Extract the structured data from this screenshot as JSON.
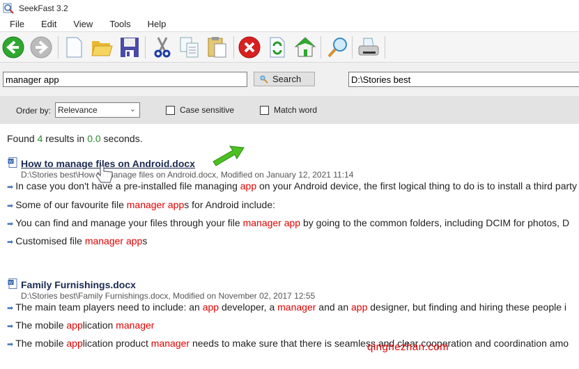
{
  "window": {
    "title": "SeekFast 3.2"
  },
  "menu": [
    "File",
    "Edit",
    "View",
    "Tools",
    "Help"
  ],
  "toolbar": {
    "buttons": [
      {
        "name": "back-icon"
      },
      {
        "name": "forward-icon",
        "disabled": true
      },
      {
        "name": "new-document-icon"
      },
      {
        "name": "open-folder-icon"
      },
      {
        "name": "save-icon"
      },
      {
        "name": "cut-icon"
      },
      {
        "name": "copy-icon"
      },
      {
        "name": "paste-icon"
      },
      {
        "name": "stop-icon"
      },
      {
        "name": "refresh-icon"
      },
      {
        "name": "home-icon"
      },
      {
        "name": "find-icon"
      },
      {
        "name": "print-icon"
      }
    ]
  },
  "search": {
    "query": "manager app",
    "button_label": "Search",
    "folder": "D:\\Stories best"
  },
  "options": {
    "order_label": "Order by:",
    "order_value": "Relevance",
    "case_sensitive_label": "Case sensitive",
    "case_sensitive": false,
    "match_word_label": "Match word",
    "match_word": false
  },
  "summary": {
    "prefix": "Found ",
    "count": "4",
    "middle": " results in ",
    "time": "0.0",
    "suffix": " seconds."
  },
  "results": [
    {
      "title": "How to manage files on Android.docx",
      "path": "D:\\Stories best\\How to manage files on Android.docx, Modified on January 12, 2021 11:14",
      "snippets": [
        [
          {
            "t": "In case you don't have a pre-installed file managing "
          },
          {
            "t": "app",
            "hl": true
          },
          {
            "t": " on your Android device, the first logical thing to do is to install a third party"
          }
        ],
        [
          {
            "t": "Some of our favourite file "
          },
          {
            "t": "manager app",
            "hl": true
          },
          {
            "t": "s for Android include:"
          }
        ],
        [
          {
            "t": "You can find and manage your files through your file "
          },
          {
            "t": "manager app",
            "hl": true
          },
          {
            "t": " by going to the common folders, including DCIM for photos, D"
          }
        ],
        [
          {
            "t": "Customised file "
          },
          {
            "t": "manager app",
            "hl": true
          },
          {
            "t": "s"
          }
        ]
      ]
    },
    {
      "title": "Family Furnishings.docx",
      "path": "D:\\Stories best\\Family Furnishings.docx, Modified on November 02, 2017 12:55",
      "snippets": [
        [
          {
            "t": "The main team players need to include: an "
          },
          {
            "t": "app",
            "hl": true
          },
          {
            "t": " developer, a "
          },
          {
            "t": "manager",
            "hl": true
          },
          {
            "t": " and an "
          },
          {
            "t": "app",
            "hl": true
          },
          {
            "t": " designer, but finding and hiring these people i"
          }
        ],
        [
          {
            "t": "The mobile "
          },
          {
            "t": "app",
            "hl": true
          },
          {
            "t": "lication "
          },
          {
            "t": "manager",
            "hl": true
          }
        ],
        [
          {
            "t": "The mobile "
          },
          {
            "t": "app",
            "hl": true
          },
          {
            "t": "lication product "
          },
          {
            "t": "manager",
            "hl": true
          },
          {
            "t": " needs to make sure that there is seamless and clear cooperation and coordination amo"
          }
        ]
      ]
    }
  ],
  "watermark": "qinghezhan.com",
  "colors": {
    "highlight": "#e00000",
    "count": "#2e8b2e",
    "option_bar": "#e3e3e3"
  }
}
